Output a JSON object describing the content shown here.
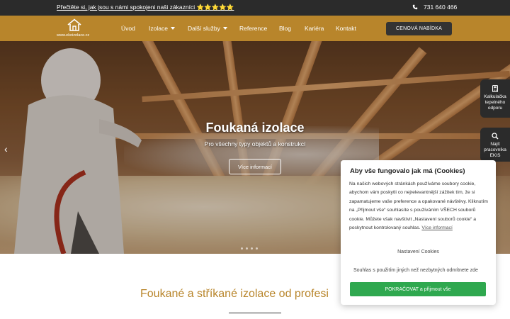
{
  "topbar": {
    "promo_link": "Přečtěte si, jak jsou s námi spokojeni naši zákazníci ⭐⭐⭐⭐⭐",
    "phone_icon": "phone-icon",
    "phone": "731 640 466"
  },
  "header": {
    "logo_text": "www.ekoizolace.cz",
    "logo_icon": "house-icon",
    "nav": {
      "home": "Úvod",
      "insulation": "Izolace",
      "services": "Další služby",
      "references": "Reference",
      "blog": "Blog",
      "career": "Kariéra",
      "contact": "Kontakt"
    },
    "cta": "CENOVÁ NABÍDKA"
  },
  "hero": {
    "title": "Foukaná izolace",
    "subtitle": "Pro všechny typy objektů a konstrukcí",
    "button": "Více informací",
    "prev_icon": "chevron-left-icon"
  },
  "side_tabs": {
    "calculator": "Kalkulačka tepelného odporu",
    "calculator_icon": "calculator-icon",
    "find_worker": "Najít pracovníka EKIS",
    "find_worker_icon": "search-icon"
  },
  "section": {
    "title": "Foukané a stříkané izolace od profesi"
  },
  "cookie": {
    "title": "Aby vše fungovalo jak má (Cookies)",
    "body": "Na našich webových stránkách používáme soubory cookie, abychom vám poskytli co nejrelevantnější zážitek tím, že si zapamatujeme vaše preference a opakované návštěvy. Kliknutím na „Přijmout vše“ souhlasíte s používáním VŠECH souborů cookie. Můžete však navštívit „Nastavení souborů cookie“ a poskytnout kontrolovaný souhlas.",
    "more_link": "Více informací",
    "settings": "Nastavení Cookies",
    "decline": "Souhlas s použitím jiných než nezbytných odmítnete zde",
    "accept": "POKRAČOVAT a přijmout vše"
  },
  "colors": {
    "brand": "#b8852b",
    "dark": "#2b2b2b",
    "accept": "#2fa84f"
  }
}
